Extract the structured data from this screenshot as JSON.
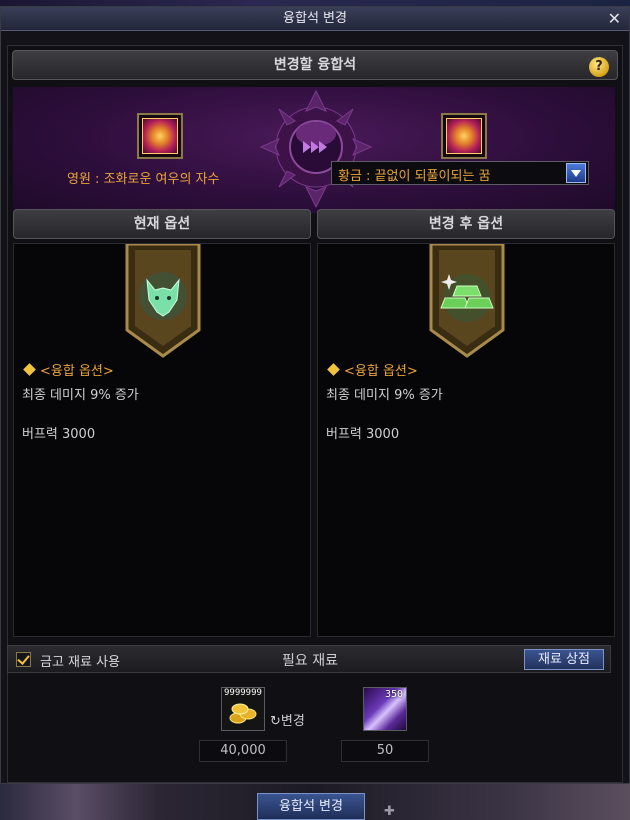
{
  "window": {
    "title": "융합석 변경",
    "close_glyph": "✕"
  },
  "header": {
    "title": "변경할 융합석",
    "help_glyph": "?"
  },
  "selection": {
    "current_item": "영원 : 조화로운 여우의 자수",
    "target_value": "황금 : 끝없이 되풀이되는 꿈"
  },
  "panels": {
    "current": {
      "title": "현재 옵션",
      "option_header": "<융합 옵션>",
      "lines": [
        "최종 데미지 9% 증가",
        "버프력 3000"
      ],
      "icon": "fox-emblem-icon"
    },
    "after": {
      "title": "변경 후 옵션",
      "option_header": "<융합 옵션>",
      "lines": [
        "최종 데미지 9% 증가",
        "버프력 3000"
      ],
      "icon": "gold-bars-emblem-icon"
    }
  },
  "materials": {
    "use_vault_label": "금고 재료 사용",
    "use_vault_checked": true,
    "required_label": "필요 재료",
    "shop_button": "재료 상점",
    "change_symbol": "↻변경",
    "gold": {
      "stack": "9999999",
      "required": "40,000",
      "icon": "gold-coins-icon"
    },
    "crystal": {
      "stack": "350",
      "required": "50",
      "icon": "crystal-icon"
    }
  },
  "footer": {
    "main_button": "융합석 변경"
  },
  "colors": {
    "accent_gold": "#e7a43a",
    "purple_bg": "#2e0e3c",
    "button_blue": "#3a5490"
  }
}
